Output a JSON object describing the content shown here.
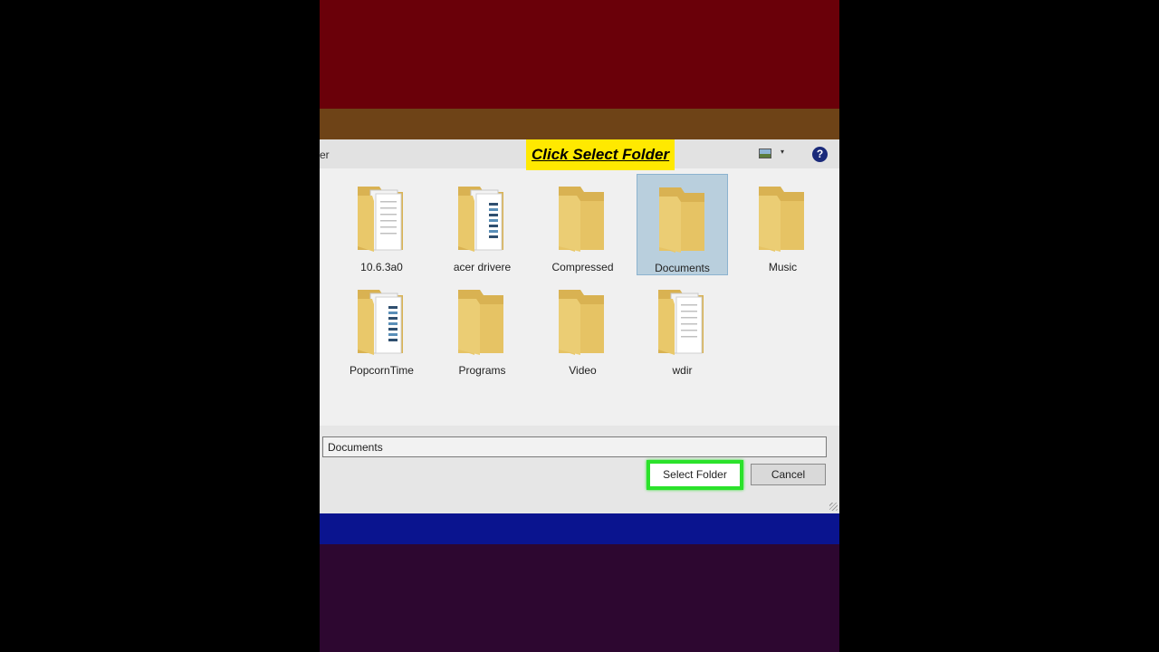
{
  "dialog": {
    "title_fragment": "er",
    "view_menu_arrow": "▾",
    "help_glyph": "?"
  },
  "annotation": {
    "text": "Click Select Folder"
  },
  "folders": [
    {
      "label": "10.6.3a0",
      "variant": "docs"
    },
    {
      "label": "acer drivere",
      "variant": "blue-doc"
    },
    {
      "label": "Compressed",
      "variant": "plain"
    },
    {
      "label": "Documents",
      "variant": "plain",
      "selected": true
    },
    {
      "label": "Music",
      "variant": "plain"
    },
    {
      "label": "PopcornTime",
      "variant": "blue-doc"
    },
    {
      "label": "Programs",
      "variant": "plain"
    },
    {
      "label": "Video",
      "variant": "plain"
    },
    {
      "label": "wdir",
      "variant": "docs"
    }
  ],
  "folder_name_field": {
    "value": "Documents"
  },
  "buttons": {
    "select_folder": "Select Folder",
    "cancel": "Cancel"
  },
  "colors": {
    "highlight_green": "#2be22b",
    "annotation_yellow": "#ffe900",
    "selection_blue": "#b9cfdd",
    "folder_yellow": "#e6c364"
  },
  "icons": {
    "view": "view-options-icon",
    "help": "help-icon",
    "folder": "folder-icon"
  }
}
